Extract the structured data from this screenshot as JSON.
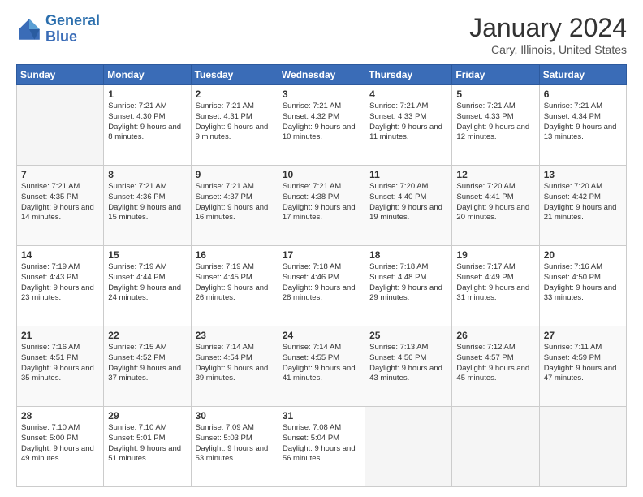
{
  "header": {
    "logo_line1": "General",
    "logo_line2": "Blue",
    "month_title": "January 2024",
    "location": "Cary, Illinois, United States"
  },
  "days_of_week": [
    "Sunday",
    "Monday",
    "Tuesday",
    "Wednesday",
    "Thursday",
    "Friday",
    "Saturday"
  ],
  "weeks": [
    [
      {
        "day": "",
        "sunrise": "",
        "sunset": "",
        "daylight": ""
      },
      {
        "day": "1",
        "sunrise": "7:21 AM",
        "sunset": "4:30 PM",
        "daylight": "9 hours and 8 minutes."
      },
      {
        "day": "2",
        "sunrise": "7:21 AM",
        "sunset": "4:31 PM",
        "daylight": "9 hours and 9 minutes."
      },
      {
        "day": "3",
        "sunrise": "7:21 AM",
        "sunset": "4:32 PM",
        "daylight": "9 hours and 10 minutes."
      },
      {
        "day": "4",
        "sunrise": "7:21 AM",
        "sunset": "4:33 PM",
        "daylight": "9 hours and 11 minutes."
      },
      {
        "day": "5",
        "sunrise": "7:21 AM",
        "sunset": "4:33 PM",
        "daylight": "9 hours and 12 minutes."
      },
      {
        "day": "6",
        "sunrise": "7:21 AM",
        "sunset": "4:34 PM",
        "daylight": "9 hours and 13 minutes."
      }
    ],
    [
      {
        "day": "7",
        "sunrise": "7:21 AM",
        "sunset": "4:35 PM",
        "daylight": "9 hours and 14 minutes."
      },
      {
        "day": "8",
        "sunrise": "7:21 AM",
        "sunset": "4:36 PM",
        "daylight": "9 hours and 15 minutes."
      },
      {
        "day": "9",
        "sunrise": "7:21 AM",
        "sunset": "4:37 PM",
        "daylight": "9 hours and 16 minutes."
      },
      {
        "day": "10",
        "sunrise": "7:21 AM",
        "sunset": "4:38 PM",
        "daylight": "9 hours and 17 minutes."
      },
      {
        "day": "11",
        "sunrise": "7:20 AM",
        "sunset": "4:40 PM",
        "daylight": "9 hours and 19 minutes."
      },
      {
        "day": "12",
        "sunrise": "7:20 AM",
        "sunset": "4:41 PM",
        "daylight": "9 hours and 20 minutes."
      },
      {
        "day": "13",
        "sunrise": "7:20 AM",
        "sunset": "4:42 PM",
        "daylight": "9 hours and 21 minutes."
      }
    ],
    [
      {
        "day": "14",
        "sunrise": "7:19 AM",
        "sunset": "4:43 PM",
        "daylight": "9 hours and 23 minutes."
      },
      {
        "day": "15",
        "sunrise": "7:19 AM",
        "sunset": "4:44 PM",
        "daylight": "9 hours and 24 minutes."
      },
      {
        "day": "16",
        "sunrise": "7:19 AM",
        "sunset": "4:45 PM",
        "daylight": "9 hours and 26 minutes."
      },
      {
        "day": "17",
        "sunrise": "7:18 AM",
        "sunset": "4:46 PM",
        "daylight": "9 hours and 28 minutes."
      },
      {
        "day": "18",
        "sunrise": "7:18 AM",
        "sunset": "4:48 PM",
        "daylight": "9 hours and 29 minutes."
      },
      {
        "day": "19",
        "sunrise": "7:17 AM",
        "sunset": "4:49 PM",
        "daylight": "9 hours and 31 minutes."
      },
      {
        "day": "20",
        "sunrise": "7:16 AM",
        "sunset": "4:50 PM",
        "daylight": "9 hours and 33 minutes."
      }
    ],
    [
      {
        "day": "21",
        "sunrise": "7:16 AM",
        "sunset": "4:51 PM",
        "daylight": "9 hours and 35 minutes."
      },
      {
        "day": "22",
        "sunrise": "7:15 AM",
        "sunset": "4:52 PM",
        "daylight": "9 hours and 37 minutes."
      },
      {
        "day": "23",
        "sunrise": "7:14 AM",
        "sunset": "4:54 PM",
        "daylight": "9 hours and 39 minutes."
      },
      {
        "day": "24",
        "sunrise": "7:14 AM",
        "sunset": "4:55 PM",
        "daylight": "9 hours and 41 minutes."
      },
      {
        "day": "25",
        "sunrise": "7:13 AM",
        "sunset": "4:56 PM",
        "daylight": "9 hours and 43 minutes."
      },
      {
        "day": "26",
        "sunrise": "7:12 AM",
        "sunset": "4:57 PM",
        "daylight": "9 hours and 45 minutes."
      },
      {
        "day": "27",
        "sunrise": "7:11 AM",
        "sunset": "4:59 PM",
        "daylight": "9 hours and 47 minutes."
      }
    ],
    [
      {
        "day": "28",
        "sunrise": "7:10 AM",
        "sunset": "5:00 PM",
        "daylight": "9 hours and 49 minutes."
      },
      {
        "day": "29",
        "sunrise": "7:10 AM",
        "sunset": "5:01 PM",
        "daylight": "9 hours and 51 minutes."
      },
      {
        "day": "30",
        "sunrise": "7:09 AM",
        "sunset": "5:03 PM",
        "daylight": "9 hours and 53 minutes."
      },
      {
        "day": "31",
        "sunrise": "7:08 AM",
        "sunset": "5:04 PM",
        "daylight": "9 hours and 56 minutes."
      },
      {
        "day": "",
        "sunrise": "",
        "sunset": "",
        "daylight": ""
      },
      {
        "day": "",
        "sunrise": "",
        "sunset": "",
        "daylight": ""
      },
      {
        "day": "",
        "sunrise": "",
        "sunset": "",
        "daylight": ""
      }
    ]
  ],
  "labels": {
    "sunrise_prefix": "Sunrise: ",
    "sunset_prefix": "Sunset: ",
    "daylight_prefix": "Daylight: "
  }
}
